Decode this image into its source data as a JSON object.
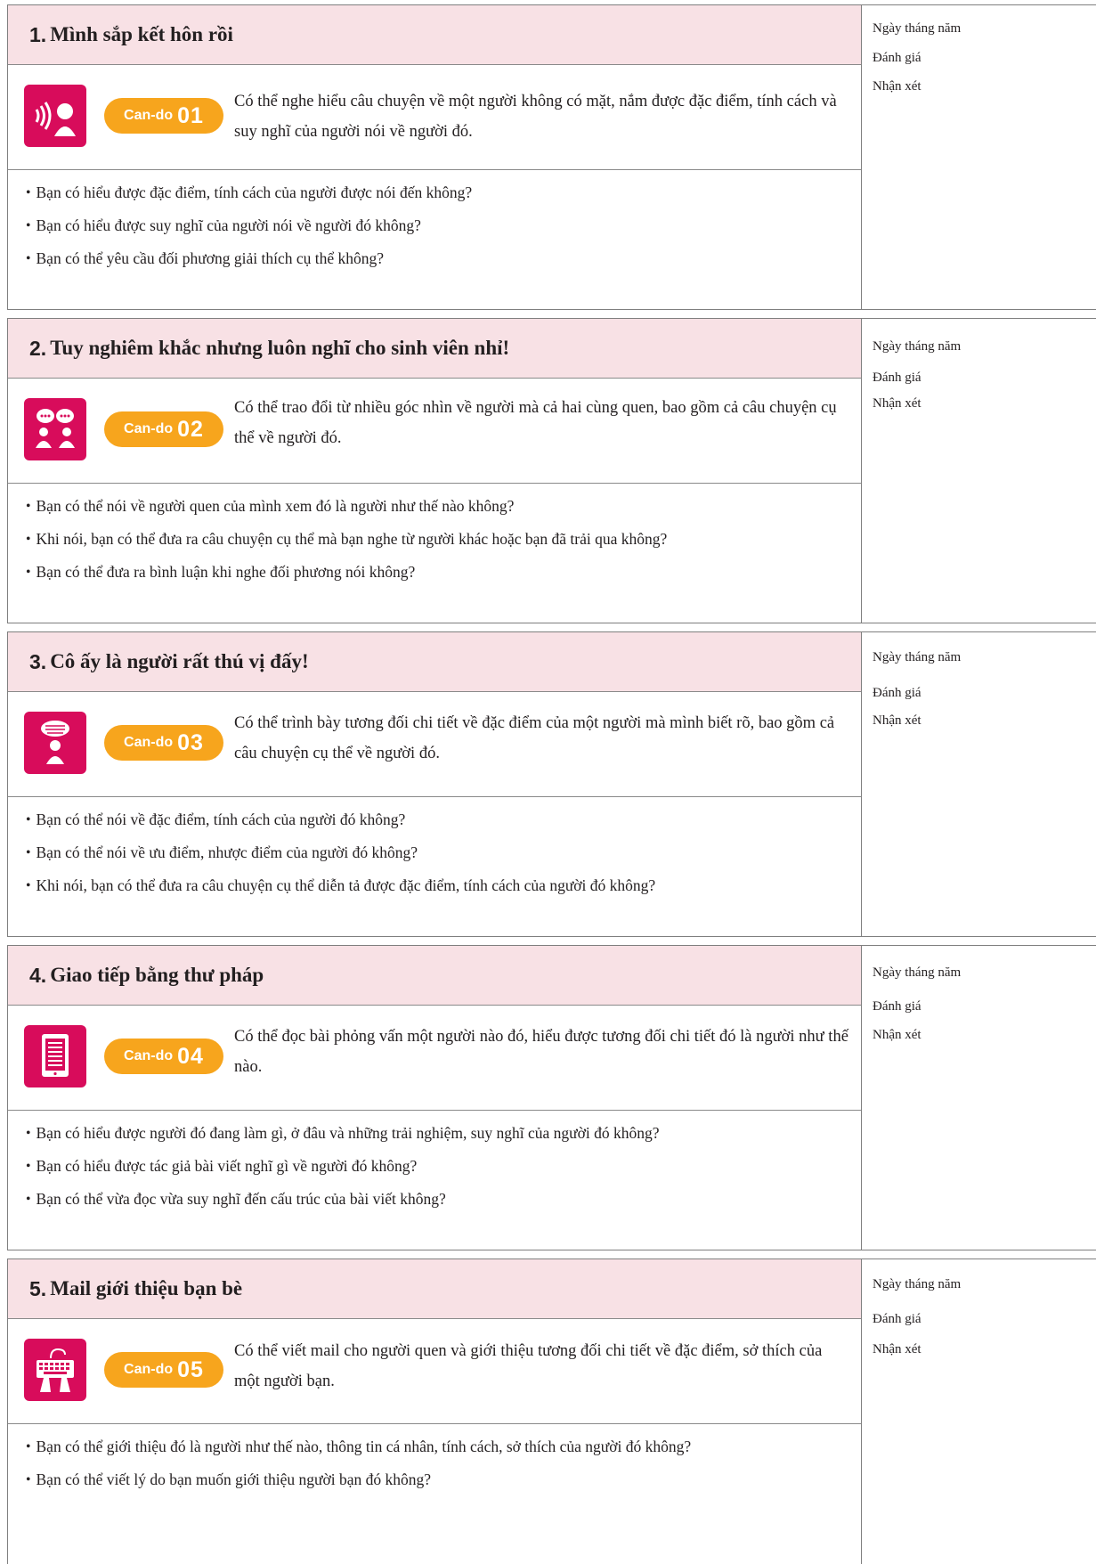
{
  "sections": [
    {
      "number": "1.",
      "title": "Mình sắp kết hôn rồi",
      "can_do_label": "Can-do",
      "can_do_number": "01",
      "icon": "listening-person-icon",
      "description": "Có thể nghe hiểu câu chuyện về một người không có mặt, nắm được đặc điểm, tính cách và suy nghĩ của người nói về người đó.",
      "points": [
        "・Bạn có hiểu được đặc điểm, tính cách của người được nói đến không?",
        "・Bạn có hiểu được suy nghĩ của người nói về người đó không?",
        "・Bạn có thể yêu cầu đối phương giải thích cụ thể không?"
      ],
      "side": {
        "date": "Ngày tháng năm",
        "rating": "Đánh giá",
        "comment": "Nhận xét"
      }
    },
    {
      "number": "2.",
      "title": "Tuy nghiêm khắc nhưng luôn nghĩ cho sinh viên nhỉ!",
      "can_do_label": "Can-do",
      "can_do_number": "02",
      "icon": "conversation-icon",
      "description": "Có thể trao đổi từ nhiều góc nhìn về người mà cả hai cùng quen, bao gồm cả câu chuyện cụ thể về người đó.",
      "points": [
        "・Bạn có thể nói về người quen của mình xem đó là người như thế nào không?",
        "・Khi nói, bạn có thể đưa ra câu chuyện cụ thể mà bạn nghe từ người khác hoặc bạn đã trải qua không?",
        "・Bạn có thể đưa ra bình luận khi nghe đối phương nói không?"
      ],
      "side": {
        "date": "Ngày tháng năm",
        "rating": "Đánh giá",
        "comment": "Nhận xét"
      }
    },
    {
      "number": "3.",
      "title": "Cô ấy là người rất thú vị đấy!",
      "can_do_label": "Can-do",
      "can_do_number": "03",
      "icon": "speech-presenter-icon",
      "description": "Có thể trình bày tương đối chi tiết về đặc điểm của một người mà mình biết rõ, bao gồm cả câu chuyện cụ thể về người đó.",
      "points": [
        "・Bạn có thể nói về đặc điểm, tính cách của người đó không?",
        "・Bạn có thể nói về ưu điểm, nhược điểm của người đó không?",
        "・Khi nói, bạn có thể đưa ra câu chuyện cụ thể diễn tả được đặc điểm, tính cách của người đó không?"
      ],
      "side": {
        "date": "Ngày tháng năm",
        "rating": "Đánh giá",
        "comment": "Nhận xét"
      }
    },
    {
      "number": "4.",
      "title": "Giao tiếp bằng thư pháp",
      "can_do_label": "Can-do",
      "can_do_number": "04",
      "icon": "reading-tablet-icon",
      "description": "Có thể đọc bài phỏng vấn một người nào đó, hiểu được tương đối chi tiết đó là người như thế nào.",
      "points": [
        "・Bạn có hiểu được người đó đang làm gì, ở đâu và những trải nghiệm, suy nghĩ của người đó không?",
        "・Bạn có hiểu được tác giả bài viết nghĩ gì về người đó không?",
        "・Bạn có thể vừa đọc vừa suy nghĩ đến cấu trúc của bài viết không?"
      ],
      "side": {
        "date": "Ngày tháng năm",
        "rating": "Đánh giá",
        "comment": "Nhận xét"
      }
    },
    {
      "number": "5.",
      "title": "Mail giới thiệu bạn bè",
      "can_do_label": "Can-do",
      "can_do_number": "05",
      "icon": "keyboard-typing-icon",
      "description": "Có thể viết mail cho người quen và giới thiệu tương đối chi tiết về đặc điểm, sở thích của một người bạn.",
      "points": [
        "・Bạn có thể giới thiệu đó là người như thế nào, thông tin cá nhân, tính cách, sở thích của người đó không?",
        "・Bạn có thể viết lý do bạn muốn giới thiệu người bạn đó không?"
      ],
      "side": {
        "date": "Ngày tháng năm",
        "rating": "Đánh giá",
        "comment": "Nhận xét"
      }
    }
  ]
}
